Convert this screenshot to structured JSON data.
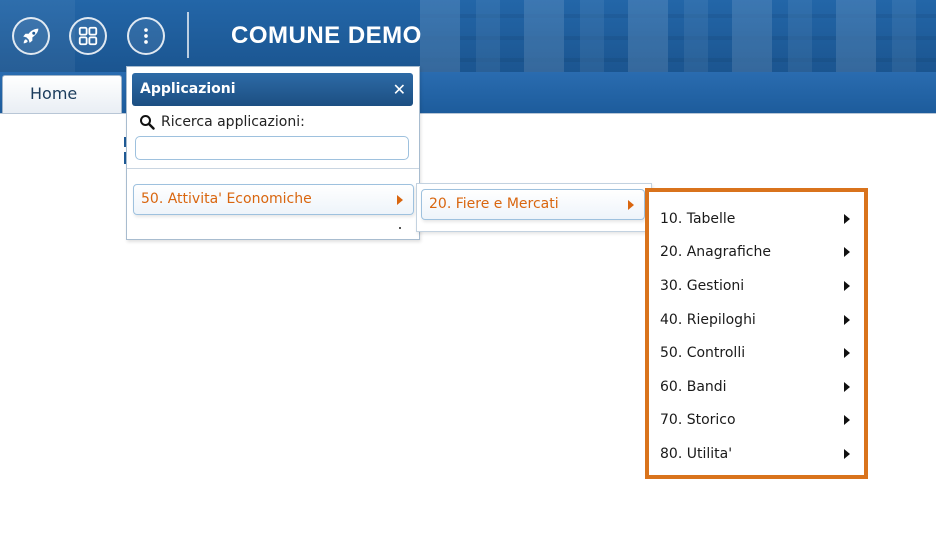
{
  "header": {
    "title": "COMUNE DEMO",
    "buttons": [
      {
        "name": "rocket-icon"
      },
      {
        "name": "grid-icon"
      },
      {
        "name": "more-vertical-icon"
      }
    ]
  },
  "tabs": [
    {
      "label": "Home"
    }
  ],
  "apps_panel": {
    "title": "Applicazioni",
    "close_icon": "close-icon",
    "search_label": "Ricerca applicazioni:",
    "search_placeholder": "",
    "search_value": "",
    "items": [
      {
        "label": "50. Attivita' Economiche"
      }
    ]
  },
  "submenu1": {
    "items": [
      {
        "label": "20. Fiere e Mercati"
      }
    ]
  },
  "submenu2": {
    "items": [
      {
        "label": "10. Tabelle"
      },
      {
        "label": "20. Anagrafiche"
      },
      {
        "label": "30. Gestioni"
      },
      {
        "label": "40. Riepiloghi"
      },
      {
        "label": "50. Controlli"
      },
      {
        "label": "60. Bandi"
      },
      {
        "label": "70. Storico"
      },
      {
        "label": "80. Utilita'"
      }
    ]
  },
  "colors": {
    "header_blue": "#1f5a96",
    "accent_orange": "#d9731c",
    "link_orange": "#d9660f"
  }
}
